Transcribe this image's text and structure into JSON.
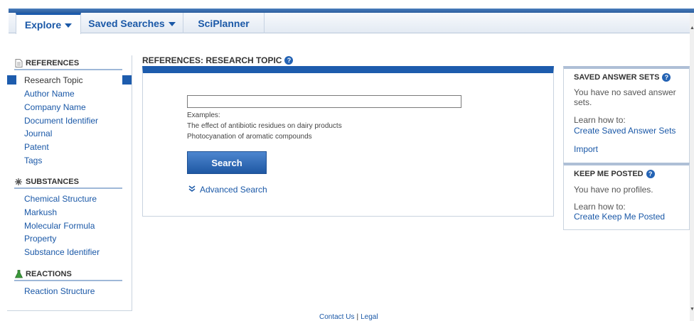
{
  "tabs": [
    {
      "label": "Explore",
      "active": true,
      "dropdown": true
    },
    {
      "label": "Saved Searches",
      "active": false,
      "dropdown": true
    },
    {
      "label": "SciPlanner",
      "active": false,
      "dropdown": false
    }
  ],
  "sidebar": {
    "references": {
      "heading": "REFERENCES",
      "icon": "document-icon",
      "items": [
        "Research Topic",
        "Author Name",
        "Company Name",
        "Document Identifier",
        "Journal",
        "Patent",
        "Tags"
      ],
      "active": "Research Topic"
    },
    "substances": {
      "heading": "SUBSTANCES",
      "icon": "molecule-icon",
      "items": [
        "Chemical Structure",
        "Markush",
        "Molecular Formula",
        "Property",
        "Substance Identifier"
      ]
    },
    "reactions": {
      "heading": "REACTIONS",
      "icon": "flask-icon",
      "items": [
        "Reaction Structure"
      ]
    }
  },
  "main": {
    "title": "REFERENCES: RESEARCH TOPIC",
    "search_value": "",
    "examples_label": "Examples:",
    "examples": [
      "The effect of antibiotic residues on dairy products",
      "Photocyanation of aromatic compounds"
    ],
    "search_button": "Search",
    "advanced_search": "Advanced Search"
  },
  "saved_answer_sets": {
    "title": "SAVED ANSWER SETS",
    "empty_text_line1": "You have no saved answer",
    "empty_text_line2": "sets.",
    "learn": "Learn how to:",
    "link_create": "Create Saved Answer Sets",
    "link_import": "Import"
  },
  "keep_me_posted": {
    "title": "KEEP ME POSTED",
    "empty_text": "You have no profiles.",
    "learn": "Learn how to:",
    "link_create": "Create Keep Me Posted"
  },
  "footer": {
    "contact": "Contact Us",
    "separator": "|",
    "legal": "Legal"
  },
  "colors": {
    "accent": "#1d5cad",
    "link": "#1a58a7"
  }
}
